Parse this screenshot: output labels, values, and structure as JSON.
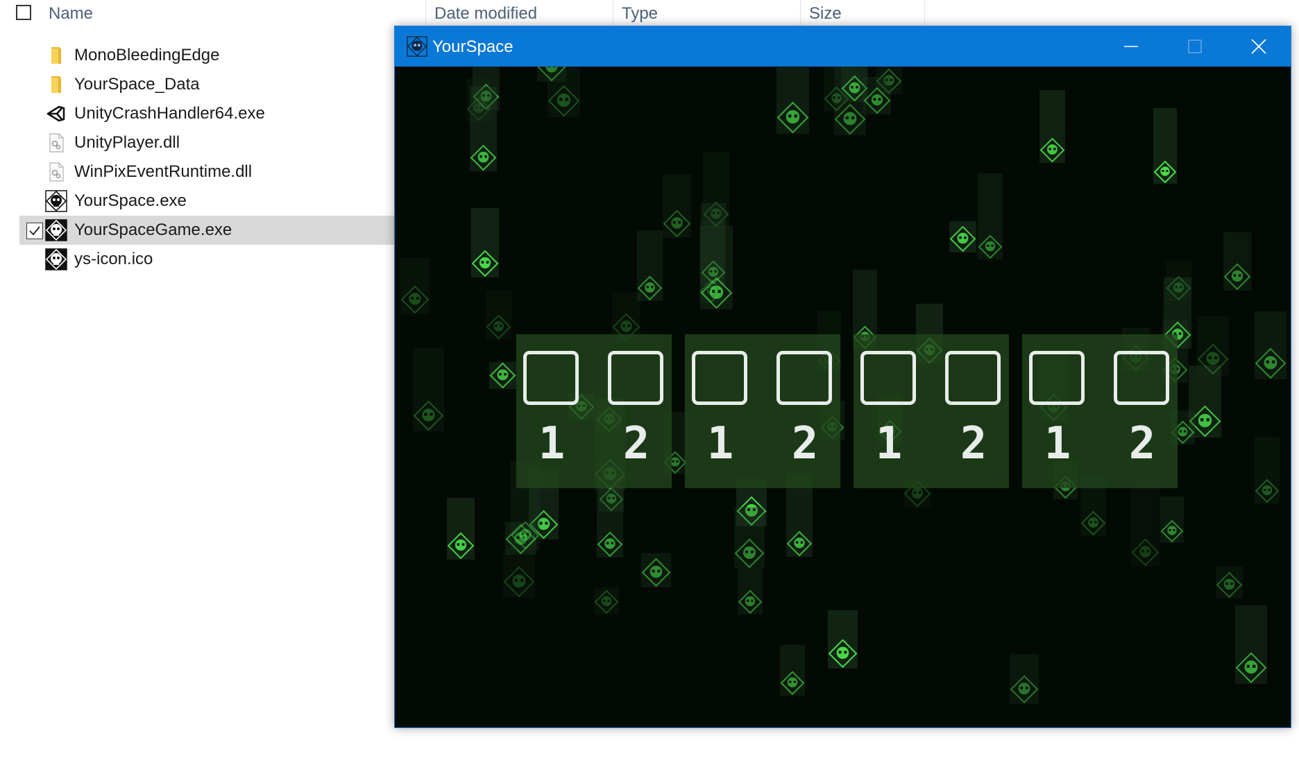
{
  "explorer": {
    "columns": {
      "name": "Name",
      "date_modified": "Date modified",
      "type": "Type",
      "size": "Size"
    },
    "files": [
      {
        "name": "MonoBleedingEdge",
        "icon": "folder-icon",
        "selected": false
      },
      {
        "name": "YourSpace_Data",
        "icon": "folder-icon",
        "selected": false
      },
      {
        "name": "UnityCrashHandler64.exe",
        "icon": "unity-icon",
        "selected": false
      },
      {
        "name": "UnityPlayer.dll",
        "icon": "dll-icon",
        "selected": false
      },
      {
        "name": "WinPixEventRuntime.dll",
        "icon": "dll-icon",
        "selected": false
      },
      {
        "name": "YourSpace.exe",
        "icon": "yourspace-skull-icon",
        "selected": false
      },
      {
        "name": "YourSpaceGame.exe",
        "icon": "yourspace-skull-icon",
        "selected": true
      },
      {
        "name": "ys-icon.ico",
        "icon": "yourspace-skull-icon",
        "selected": false
      }
    ]
  },
  "window": {
    "title": "YourSpace",
    "titlebar_color": "#0a78d7"
  },
  "game": {
    "background_color": "#030a04",
    "accent_color": "#4bdc4b",
    "slot_groups": [
      {
        "slots": [
          {
            "label": "1"
          },
          {
            "label": "2"
          }
        ]
      },
      {
        "slots": [
          {
            "label": "1"
          },
          {
            "label": "2"
          }
        ]
      },
      {
        "slots": [
          {
            "label": "1"
          },
          {
            "label": "2"
          }
        ]
      },
      {
        "slots": [
          {
            "label": "1"
          },
          {
            "label": "2"
          }
        ]
      }
    ]
  }
}
